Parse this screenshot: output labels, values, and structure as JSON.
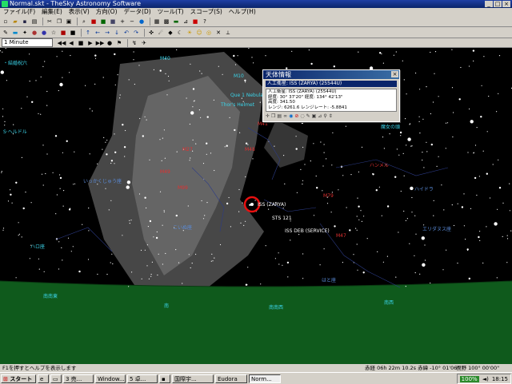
{
  "window": {
    "title": "Normal.skt - TheSky Astronomy Software"
  },
  "menu": [
    "ファイル(F)",
    "編集(E)",
    "表示(V)",
    "方向(O)",
    "データ(D)",
    "ツール(T)",
    "スコープ(S)",
    "ヘルプ(H)"
  ],
  "toolbar": {
    "time_step": "1 Minute"
  },
  "sky_labels": [
    {
      "t": "・結婚祝六",
      "c": "cyan"
    },
    {
      "t": "M40",
      "c": "cyan"
    },
    {
      "t": "M10",
      "c": "cyan"
    },
    {
      "t": "Que 1 Nebula",
      "c": "cyan"
    },
    {
      "t": "Thor's Helmet",
      "c": "cyan"
    },
    {
      "t": "M41",
      "c": "red"
    },
    {
      "t": "S·ヘルドル",
      "c": "cyan"
    },
    {
      "t": "M27",
      "c": "red"
    },
    {
      "t": "M48",
      "c": "red"
    },
    {
      "t": "M49",
      "c": "red"
    },
    {
      "t": "M99",
      "c": "red"
    },
    {
      "t": "いっかくじゅう座",
      "c": "blue"
    },
    {
      "t": "こいぬ座",
      "c": "blue"
    },
    {
      "t": "ISS (ZARYA)",
      "c": "white"
    },
    {
      "t": "STS 121",
      "c": "white"
    },
    {
      "t": "ISS DEB (SERVICE)",
      "c": "white"
    },
    {
      "t": "ハンメル",
      "c": "red"
    },
    {
      "t": "ハイドラ",
      "c": "blue"
    },
    {
      "t": "M79",
      "c": "red"
    },
    {
      "t": "M47",
      "c": "red"
    },
    {
      "t": "エリダヌス座",
      "c": "blue"
    },
    {
      "t": "はと座",
      "c": "blue"
    },
    {
      "t": "ハロ座",
      "c": "cyan"
    },
    {
      "t": "魔女の頭",
      "c": "cyan"
    },
    {
      "t": "南南東",
      "c": "cyan"
    },
    {
      "t": "南",
      "c": "cyan"
    },
    {
      "t": "南南西",
      "c": "cyan"
    },
    {
      "t": "南西",
      "c": "cyan"
    }
  ],
  "dialog": {
    "title": "天体情報",
    "selected": "人工衛星: ISS (ZARYA) (25544U)",
    "lines": [
      "人工衛星: ISS (ZARYA) (25544U)",
      "経度: 30° 37'20\"  経度: 134° 42'13\"",
      "高度: 341.50",
      "レンジ: 6261.6 レンジレート: -5.8841"
    ]
  },
  "status": {
    "hint": "F1を押すとヘルプを表示します",
    "coords": "赤経 06h 22m 10.2s  赤緯 -10° 01'06\"",
    "fov": "視野 100° 00'00\""
  },
  "taskbar": {
    "start": "スタート",
    "tasks": [
      "3 売...",
      "Window...",
      "5 卓...",
      "国際宇...",
      "Eudora",
      "Norm..."
    ],
    "battery": "100%",
    "clock": "18:15"
  },
  "colors": {
    "sky": "#000000",
    "milkyway": "#6a6a6a",
    "ground": "#0f5a1c",
    "selection_circle": "#e81010"
  }
}
